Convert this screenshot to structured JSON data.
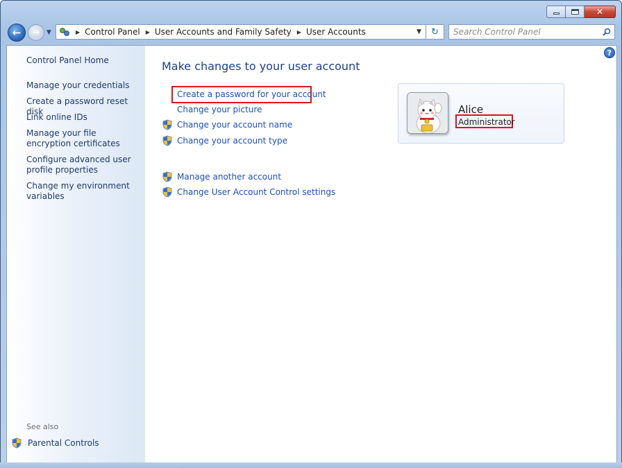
{
  "window": {
    "caption_buttons": [
      "minimize",
      "maximize",
      "close"
    ]
  },
  "nav": {
    "breadcrumbs": [
      "Control Panel",
      "User Accounts and Family Safety",
      "User Accounts"
    ],
    "search_placeholder": "Search Control Panel"
  },
  "sidebar": {
    "home": "Control Panel Home",
    "items": [
      {
        "label": "Manage your credentials"
      },
      {
        "label": "Create a password reset disk"
      },
      {
        "label": "Link online IDs"
      },
      {
        "label": "Manage your file encryption certificates"
      },
      {
        "label": "Configure advanced user profile properties"
      },
      {
        "label": "Change my environment variables"
      }
    ],
    "see_also_title": "See also",
    "see_also_items": [
      {
        "label": "Parental Controls",
        "icon": "shield-icon"
      }
    ]
  },
  "main": {
    "heading": "Make changes to your user account",
    "tasks": [
      {
        "label": "Create a password for your account",
        "icon": "none",
        "highlighted": true
      },
      {
        "label": "Change your picture",
        "icon": "none"
      },
      {
        "label": "Change your account name",
        "icon": "shield-icon"
      },
      {
        "label": "Change your account type",
        "icon": "shield-icon"
      }
    ],
    "other_tasks": [
      {
        "label": "Manage another account",
        "icon": "shield-icon"
      },
      {
        "label": "Change User Account Control settings",
        "icon": "shield-icon"
      }
    ],
    "account": {
      "name": "Alice",
      "role": "Administrator",
      "role_highlighted": true
    },
    "help_icon": "help-icon"
  },
  "colors": {
    "link": "#1b4fb6",
    "heading": "#1e3f8a",
    "highlight_box": "#e1101e",
    "sidebar_link": "#1e3a6e"
  }
}
